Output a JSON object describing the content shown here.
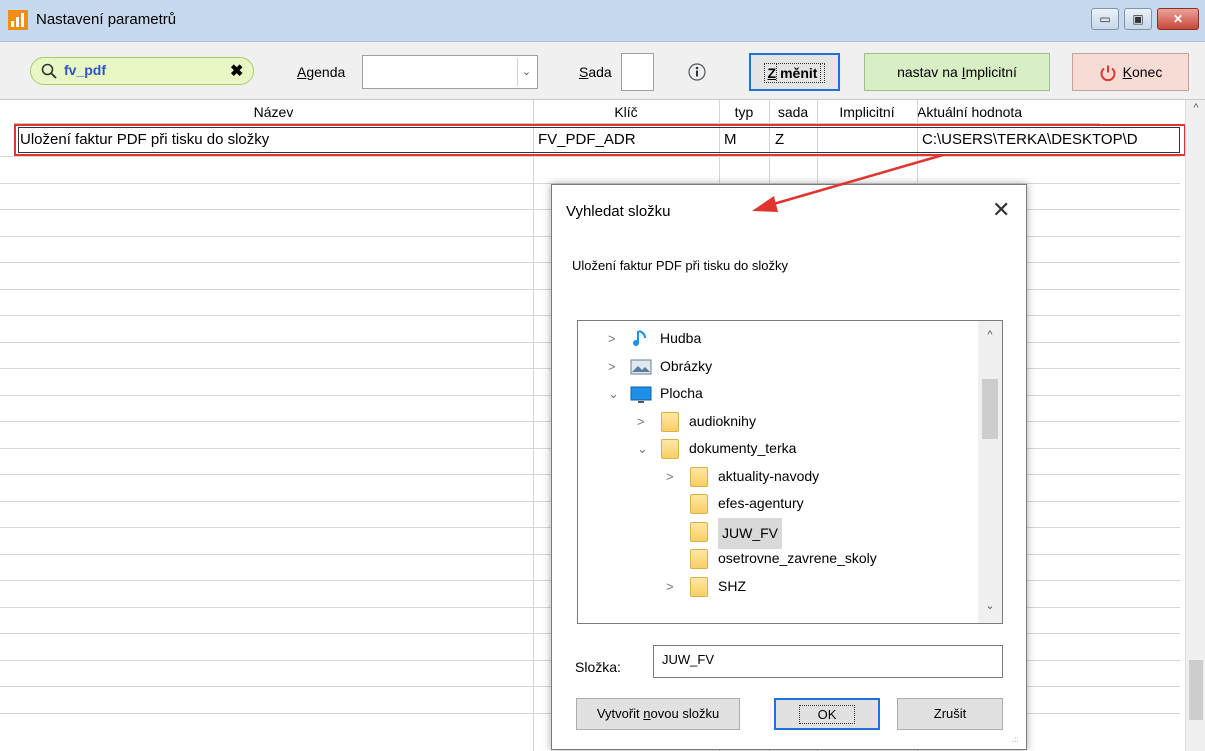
{
  "window": {
    "title": "Nastavení parametrů",
    "min_glyph": "▭",
    "max_glyph": "▣",
    "close_glyph": "✕"
  },
  "toolbar": {
    "search_value": "fv_pdf",
    "clear_glyph": "✖",
    "agenda_label_u": "A",
    "agenda_label_rest": "genda",
    "agenda_value": "",
    "combo_arrow": "⌄",
    "sada_label_u": "S",
    "sada_label_rest": "ada",
    "sada_value": "",
    "change_label_u": "Z",
    "change_label_rest": "měnit",
    "implicit_label_pre": "nastav na ",
    "implicit_label_u": "I",
    "implicit_label_rest": "mplicitní",
    "end_label_u": "K",
    "end_label_rest": "onec",
    "accent": "#1f73d6"
  },
  "grid": {
    "columns": [
      "Název",
      "Klíč",
      "typ",
      "sada",
      "Implicitní",
      "Aktuální hodnota"
    ],
    "rows": [
      {
        "nazev": "Uložení faktur PDF při tisku do složky",
        "klic": "FV_PDF_ADR",
        "typ": "M",
        "sada": "Z",
        "implicitni": "",
        "hodnota": "C:\\USERS\\TERKA\\DESKTOP\\D"
      }
    ],
    "scroll_up": "^",
    "highlight_color": "#e0342e"
  },
  "dialog": {
    "title": "Vyhledat složku",
    "close_glyph": "✕",
    "description": "Uložení faktur PDF při tisku do složky",
    "tree": [
      {
        "label": "Hudba",
        "icon": "music-icon",
        "expanded": false,
        "has_children": true
      },
      {
        "label": "Obrázky",
        "icon": "pictures-icon",
        "expanded": false,
        "has_children": true
      },
      {
        "label": "Plocha",
        "icon": "desktop-icon",
        "expanded": true,
        "has_children": true
      },
      {
        "label": "audioknihy",
        "icon": "folder-icon",
        "expanded": false,
        "has_children": true
      },
      {
        "label": "dokumenty_terka",
        "icon": "folder-icon",
        "expanded": true,
        "has_children": true
      },
      {
        "label": "aktuality-navody",
        "icon": "folder-icon",
        "expanded": false,
        "has_children": true
      },
      {
        "label": "efes-agentury",
        "icon": "folder-icon",
        "expanded": false,
        "has_children": false
      },
      {
        "label": "JUW_FV",
        "icon": "folder-icon",
        "expanded": false,
        "has_children": false,
        "selected": true
      },
      {
        "label": "osetrovne_zavrene_skoly",
        "icon": "folder-icon",
        "expanded": false,
        "has_children": false
      },
      {
        "label": "SHZ",
        "icon": "folder-icon",
        "expanded": false,
        "has_children": true
      }
    ],
    "collapsed_glyph": ">",
    "expanded_glyph": "⌄",
    "tree_scroll_up": "^",
    "tree_scroll_down": "⌄",
    "folder_label": "Složka:",
    "folder_value": "JUW_FV",
    "new_folder_pre": "Vytvořit ",
    "new_folder_u": "n",
    "new_folder_rest": "ovou složku",
    "ok_label": "OK",
    "cancel_label": "Zrušit",
    "grip_glyph": ".::"
  }
}
